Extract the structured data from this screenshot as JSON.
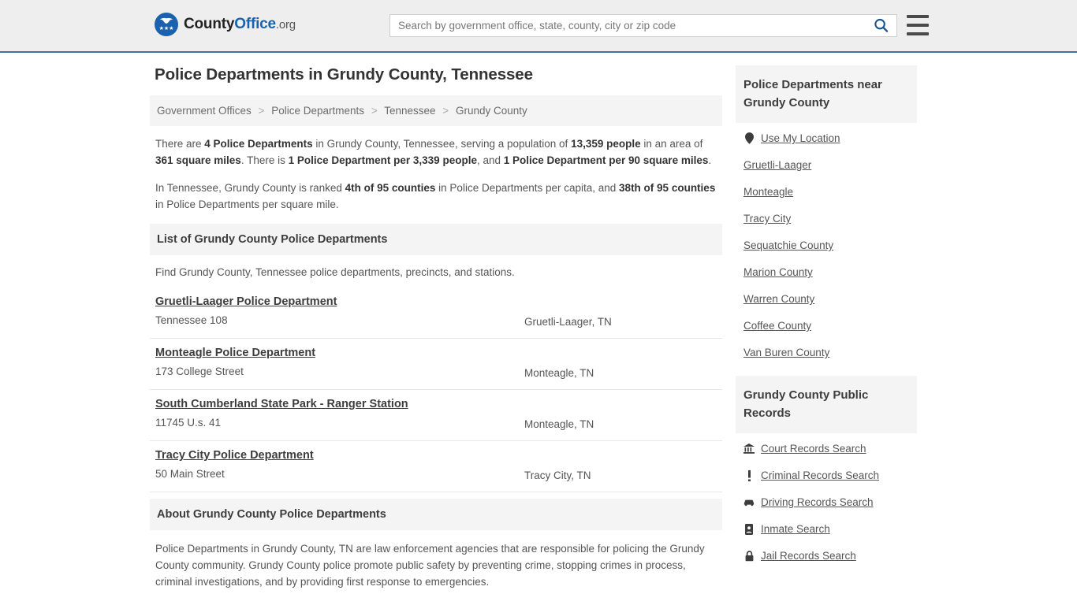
{
  "header": {
    "logo": {
      "name_part1": "County",
      "name_part2": "Office",
      "suffix": ".org",
      "mark_icon": "eagle-icon",
      "stars": "★★★"
    },
    "search": {
      "placeholder": "Search by government office, state, county, city or zip code",
      "value": "",
      "search_icon": "search-icon"
    },
    "menu_icon": "hamburger-menu-icon"
  },
  "page": {
    "title": "Police Departments in Grundy County, Tennessee"
  },
  "breadcrumb": {
    "items": [
      {
        "label": "Government Offices"
      },
      {
        "label": "Police Departments"
      },
      {
        "label": "Tennessee"
      },
      {
        "label": "Grundy County"
      }
    ],
    "separator": ">"
  },
  "intro": {
    "p1": {
      "t1": "There are ",
      "b1": "4 Police Departments",
      "t2": " in Grundy County, Tennessee, serving a population of ",
      "b2": "13,359 people",
      "t3": " in an area of ",
      "b3": "361 square miles",
      "t4": ". There is ",
      "b4": "1 Police Department per 3,339 people",
      "t5": ", and ",
      "b5": "1 Police Department per 90 square miles",
      "t6": "."
    },
    "p2": {
      "t1": "In Tennessee, Grundy County is ranked ",
      "b1": "4th of 95 counties",
      "t2": " in Police Departments per capita, and ",
      "b2": "38th of 95 counties",
      "t3": " in Police Departments per square mile."
    }
  },
  "list_section": {
    "heading": "List of Grundy County Police Departments",
    "subtext": "Find Grundy County, Tennessee police departments, precincts, and stations.",
    "items": [
      {
        "name": "Gruetli-Laager Police Department",
        "address": "Tennessee 108",
        "city": "Gruetli-Laager, TN"
      },
      {
        "name": "Monteagle Police Department",
        "address": "173 College Street",
        "city": "Monteagle, TN"
      },
      {
        "name": "South Cumberland State Park - Ranger Station",
        "address": "11745 U.s. 41",
        "city": "Monteagle, TN"
      },
      {
        "name": "Tracy City Police Department",
        "address": "50 Main Street",
        "city": "Tracy City, TN"
      }
    ]
  },
  "about_section": {
    "heading": "About Grundy County Police Departments",
    "text": "Police Departments in Grundy County, TN are law enforcement agencies that are responsible for policing the Grundy County community. Grundy County police promote public safety by preventing crime, stopping crimes in process, criminal investigations, and by providing first response to emergencies."
  },
  "sidebar": {
    "nearby": {
      "heading": "Police Departments near Grundy County",
      "items": [
        {
          "label": "Use My Location",
          "icon": "map-pin-icon"
        },
        {
          "label": "Gruetli-Laager",
          "icon": ""
        },
        {
          "label": "Monteagle",
          "icon": ""
        },
        {
          "label": "Tracy City",
          "icon": ""
        },
        {
          "label": "Sequatchie County",
          "icon": ""
        },
        {
          "label": "Marion County",
          "icon": ""
        },
        {
          "label": "Warren County",
          "icon": ""
        },
        {
          "label": "Coffee County",
          "icon": ""
        },
        {
          "label": "Van Buren County",
          "icon": ""
        }
      ]
    },
    "records": {
      "heading": "Grundy County Public Records",
      "items": [
        {
          "label": "Court Records Search",
          "icon": "courthouse-icon",
          "glyph": "🏛"
        },
        {
          "label": "Criminal Records Search",
          "icon": "exclamation-icon",
          "glyph": "!"
        },
        {
          "label": "Driving Records Search",
          "icon": "car-icon",
          "glyph": "🚘"
        },
        {
          "label": "Inmate Search",
          "icon": "id-badge-icon",
          "glyph": "📇"
        },
        {
          "label": "Jail Records Search",
          "icon": "lock-icon",
          "glyph": "🔒"
        }
      ]
    }
  },
  "colors": {
    "header_bg": "#eeeeee",
    "header_border": "#3f6fa6",
    "brand_blue": "#1a62ad",
    "panel_bg": "#f4f4f4",
    "text_dark": "#3d3d3d",
    "text_body": "#555555"
  }
}
